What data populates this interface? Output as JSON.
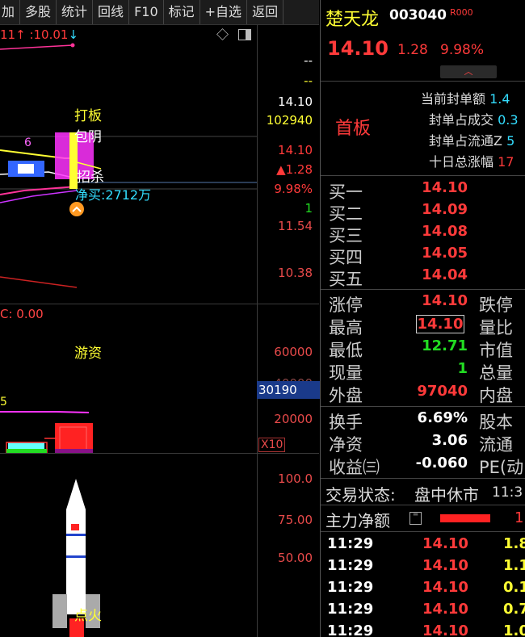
{
  "menu": [
    "加",
    "多股",
    "统计",
    "回线",
    "F10",
    "标记",
    "+自选",
    "返回"
  ],
  "chart": {
    "header_left": "11",
    "header_up_arrow": "↑",
    "header_value": ":10.01",
    "header_down_arrow": "↓",
    "price_labels": [
      "--",
      "--",
      "14.10",
      "102940",
      "14.10",
      "▲1.28",
      "9.98%",
      "1",
      "11.54",
      "10.38"
    ],
    "annotations": {
      "daban": "打板",
      "baoyin": "包阴",
      "zhaosha": "招杀",
      "num6": "6",
      "net_buy": "净买:2712万",
      "indicator": "C: 0.00",
      "youzi": "游资",
      "num5": "5",
      "dianhuo": "点火"
    },
    "volume_labels": [
      "60000",
      "40000",
      "20000"
    ],
    "volume_highlight": "30190",
    "volume_multiplier": "X10",
    "bottom_labels": [
      "100.0",
      "75.00",
      "50.00"
    ]
  },
  "stock": {
    "name": "楚天龙",
    "code": "003040",
    "badge": "R000",
    "price": "14.10",
    "change": "1.28",
    "pct": "9.98%",
    "board": "首板",
    "seal_rows": [
      {
        "label": "当前封单额",
        "value": "1.4"
      },
      {
        "label": "封单占成交",
        "value": "0.3"
      },
      {
        "label": "封单占流通Z",
        "value": "5"
      },
      {
        "label": "十日总涨幅",
        "value": "17"
      }
    ]
  },
  "order_book": [
    {
      "label": "买一",
      "price": "14.10"
    },
    {
      "label": "买二",
      "price": "14.09"
    },
    {
      "label": "买三",
      "price": "14.08"
    },
    {
      "label": "买四",
      "price": "14.05"
    },
    {
      "label": "买五",
      "price": "14.04"
    }
  ],
  "stats": [
    {
      "l1": "涨停",
      "v1": "14.10",
      "c1": "red",
      "l2": "跌停"
    },
    {
      "l1": "最高",
      "v1": "14.10",
      "c1": "red",
      "l2": "量比",
      "boxed": true
    },
    {
      "l1": "最低",
      "v1": "12.71",
      "c1": "green",
      "l2": "市值"
    },
    {
      "l1": "现量",
      "v1": "1",
      "c1": "green",
      "l2": "总量"
    },
    {
      "l1": "外盘",
      "v1": "97040",
      "c1": "red",
      "l2": "内盘"
    },
    {
      "l1": "换手",
      "v1": "6.69%",
      "c1": "white",
      "l2": "股本"
    },
    {
      "l1": "净资",
      "v1": "3.06",
      "c1": "white",
      "l2": "流通"
    },
    {
      "l1": "收益㈢",
      "v1": "-0.060",
      "c1": "white",
      "l2": "PE(动"
    }
  ],
  "trade_status": {
    "label": "交易状态:",
    "value": "盘中休市",
    "time": "11:3"
  },
  "main_net": {
    "label": "主力净额",
    "value": "1"
  },
  "ticks": [
    {
      "time": "11:29",
      "price": "14.10",
      "vol": "1.8"
    },
    {
      "time": "11:29",
      "price": "14.10",
      "vol": "1.1"
    },
    {
      "time": "11:29",
      "price": "14.10",
      "vol": "0.1"
    },
    {
      "time": "11:29",
      "price": "14.10",
      "vol": "0.7"
    },
    {
      "time": "11:29",
      "price": "14.10",
      "vol": "1.0"
    }
  ]
}
